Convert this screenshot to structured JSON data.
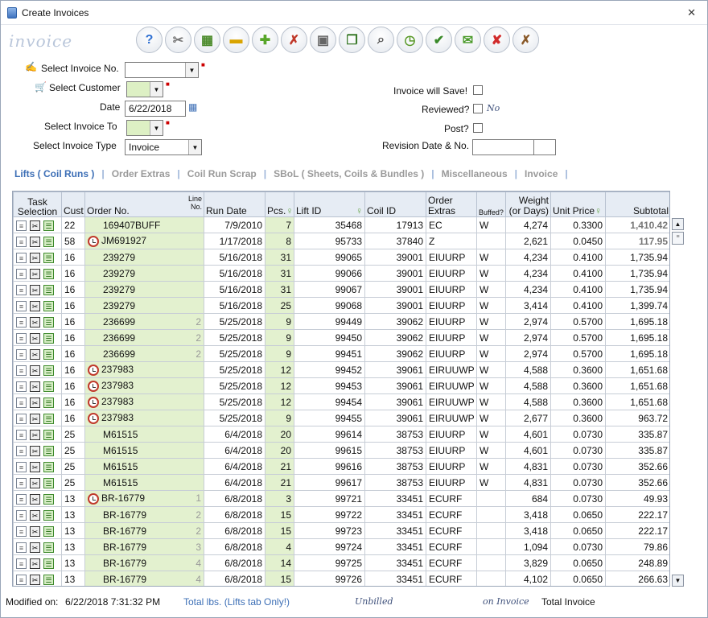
{
  "window": {
    "title": "Create Invoices",
    "close": "✕"
  },
  "logo": "invoice",
  "toolbar": [
    {
      "name": "help-icon",
      "glyph": "?",
      "color": "#2e6fd1"
    },
    {
      "name": "tools-icon",
      "glyph": "✂",
      "color": "#777"
    },
    {
      "name": "grid-icon",
      "glyph": "▦",
      "color": "#4a8a2a"
    },
    {
      "name": "note-icon",
      "glyph": "▬",
      "color": "#d9a400"
    },
    {
      "name": "add-icon",
      "glyph": "✚",
      "color": "#58a62a"
    },
    {
      "name": "remove-filter-icon",
      "glyph": "✗",
      "color": "#c0392b"
    },
    {
      "name": "save-icon",
      "glyph": "▣",
      "color": "#666"
    },
    {
      "name": "copy-icon",
      "glyph": "❐",
      "color": "#3a7a2a"
    },
    {
      "name": "preview-icon",
      "glyph": "⌕",
      "color": "#555"
    },
    {
      "name": "clock-icon",
      "glyph": "◷",
      "color": "#5a9a2a"
    },
    {
      "name": "approve-icon",
      "glyph": "✔",
      "color": "#3a8a2a"
    },
    {
      "name": "email-icon",
      "glyph": "✉",
      "color": "#4a9a2a"
    },
    {
      "name": "delete-icon",
      "glyph": "✘",
      "color": "#d12b2b"
    },
    {
      "name": "cancel-icon",
      "glyph": "✗",
      "color": "#8a5a2a"
    }
  ],
  "form": {
    "select_invoice_label": "Select Invoice No.",
    "select_customer_label": "Select Customer",
    "date_label": "Date",
    "date_value": "6/22/2018",
    "invoice_to_label": "Select Invoice To",
    "invoice_type_label": "Select Invoice Type",
    "invoice_type_value": "Invoice",
    "will_save_label": "Invoice will Save!",
    "reviewed_label": "Reviewed?",
    "reviewed_value": "No",
    "post_label": "Post?",
    "revision_label": "Revision Date & No."
  },
  "tabs": [
    "Lifts ( Coil Runs )",
    "Order Extras",
    "Coil Run Scrap",
    "SBoL ( Sheets, Coils & Bundles )",
    "Miscellaneous",
    "Invoice"
  ],
  "grid": {
    "headers": {
      "task": "Task Selection",
      "cust": "Cust",
      "order": "Order No.",
      "line": "Line No.",
      "run_date": "Run Date",
      "pcs": "Pcs.",
      "lift": "Lift ID",
      "coil": "Coil ID",
      "extras": "Order Extras",
      "buffed": "Buffed?",
      "weight": "Weight (or Days)",
      "price": "Unit Price",
      "subtotal": "Subtotal"
    },
    "rows": [
      {
        "cust": "22",
        "order": "169407BUFF",
        "line": "",
        "clock": false,
        "date": "7/9/2010",
        "pcs": "7",
        "lift": "35468",
        "coil": "17913",
        "extras": "EC",
        "buffed": "W",
        "weight": "4,274",
        "price": "0.3300",
        "subtotal": "1,410.42",
        "gray": true
      },
      {
        "cust": "58",
        "order": "JM691927",
        "line": "",
        "clock": true,
        "date": "1/17/2018",
        "pcs": "8",
        "lift": "95733",
        "coil": "37840",
        "extras": "Z",
        "buffed": "",
        "weight": "2,621",
        "price": "0.0450",
        "subtotal": "117.95",
        "gray": true
      },
      {
        "cust": "16",
        "order": "239279",
        "line": "",
        "clock": false,
        "date": "5/16/2018",
        "pcs": "31",
        "lift": "99065",
        "coil": "39001",
        "extras": "EIUURP",
        "buffed": "W",
        "weight": "4,234",
        "price": "0.4100",
        "subtotal": "1,735.94",
        "gray": false
      },
      {
        "cust": "16",
        "order": "239279",
        "line": "",
        "clock": false,
        "date": "5/16/2018",
        "pcs": "31",
        "lift": "99066",
        "coil": "39001",
        "extras": "EIUURP",
        "buffed": "W",
        "weight": "4,234",
        "price": "0.4100",
        "subtotal": "1,735.94",
        "gray": false
      },
      {
        "cust": "16",
        "order": "239279",
        "line": "",
        "clock": false,
        "date": "5/16/2018",
        "pcs": "31",
        "lift": "99067",
        "coil": "39001",
        "extras": "EIUURP",
        "buffed": "W",
        "weight": "4,234",
        "price": "0.4100",
        "subtotal": "1,735.94",
        "gray": false
      },
      {
        "cust": "16",
        "order": "239279",
        "line": "",
        "clock": false,
        "date": "5/16/2018",
        "pcs": "25",
        "lift": "99068",
        "coil": "39001",
        "extras": "EIUURP",
        "buffed": "W",
        "weight": "3,414",
        "price": "0.4100",
        "subtotal": "1,399.74",
        "gray": false
      },
      {
        "cust": "16",
        "order": "236699",
        "line": "2",
        "clock": false,
        "date": "5/25/2018",
        "pcs": "9",
        "lift": "99449",
        "coil": "39062",
        "extras": "EIUURP",
        "buffed": "W",
        "weight": "2,974",
        "price": "0.5700",
        "subtotal": "1,695.18",
        "gray": false
      },
      {
        "cust": "16",
        "order": "236699",
        "line": "2",
        "clock": false,
        "date": "5/25/2018",
        "pcs": "9",
        "lift": "99450",
        "coil": "39062",
        "extras": "EIUURP",
        "buffed": "W",
        "weight": "2,974",
        "price": "0.5700",
        "subtotal": "1,695.18",
        "gray": false
      },
      {
        "cust": "16",
        "order": "236699",
        "line": "2",
        "clock": false,
        "date": "5/25/2018",
        "pcs": "9",
        "lift": "99451",
        "coil": "39062",
        "extras": "EIUURP",
        "buffed": "W",
        "weight": "2,974",
        "price": "0.5700",
        "subtotal": "1,695.18",
        "gray": false
      },
      {
        "cust": "16",
        "order": "237983",
        "line": "",
        "clock": true,
        "date": "5/25/2018",
        "pcs": "12",
        "lift": "99452",
        "coil": "39061",
        "extras": "EIRUUWP",
        "buffed": "W",
        "weight": "4,588",
        "price": "0.3600",
        "subtotal": "1,651.68",
        "gray": false
      },
      {
        "cust": "16",
        "order": "237983",
        "line": "",
        "clock": true,
        "date": "5/25/2018",
        "pcs": "12",
        "lift": "99453",
        "coil": "39061",
        "extras": "EIRUUWP",
        "buffed": "W",
        "weight": "4,588",
        "price": "0.3600",
        "subtotal": "1,651.68",
        "gray": false
      },
      {
        "cust": "16",
        "order": "237983",
        "line": "",
        "clock": true,
        "date": "5/25/2018",
        "pcs": "12",
        "lift": "99454",
        "coil": "39061",
        "extras": "EIRUUWP",
        "buffed": "W",
        "weight": "4,588",
        "price": "0.3600",
        "subtotal": "1,651.68",
        "gray": false
      },
      {
        "cust": "16",
        "order": "237983",
        "line": "",
        "clock": true,
        "date": "5/25/2018",
        "pcs": "9",
        "lift": "99455",
        "coil": "39061",
        "extras": "EIRUUWP",
        "buffed": "W",
        "weight": "2,677",
        "price": "0.3600",
        "subtotal": "963.72",
        "gray": false
      },
      {
        "cust": "25",
        "order": "M61515",
        "line": "",
        "clock": false,
        "date": "6/4/2018",
        "pcs": "20",
        "lift": "99614",
        "coil": "38753",
        "extras": "EIUURP",
        "buffed": "W",
        "weight": "4,601",
        "price": "0.0730",
        "subtotal": "335.87",
        "gray": false
      },
      {
        "cust": "25",
        "order": "M61515",
        "line": "",
        "clock": false,
        "date": "6/4/2018",
        "pcs": "20",
        "lift": "99615",
        "coil": "38753",
        "extras": "EIUURP",
        "buffed": "W",
        "weight": "4,601",
        "price": "0.0730",
        "subtotal": "335.87",
        "gray": false
      },
      {
        "cust": "25",
        "order": "M61515",
        "line": "",
        "clock": false,
        "date": "6/4/2018",
        "pcs": "21",
        "lift": "99616",
        "coil": "38753",
        "extras": "EIUURP",
        "buffed": "W",
        "weight": "4,831",
        "price": "0.0730",
        "subtotal": "352.66",
        "gray": false
      },
      {
        "cust": "25",
        "order": "M61515",
        "line": "",
        "clock": false,
        "date": "6/4/2018",
        "pcs": "21",
        "lift": "99617",
        "coil": "38753",
        "extras": "EIUURP",
        "buffed": "W",
        "weight": "4,831",
        "price": "0.0730",
        "subtotal": "352.66",
        "gray": false
      },
      {
        "cust": "13",
        "order": "BR-16779",
        "line": "1",
        "clock": true,
        "date": "6/8/2018",
        "pcs": "3",
        "lift": "99721",
        "coil": "33451",
        "extras": "ECURF",
        "buffed": "",
        "weight": "684",
        "price": "0.0730",
        "subtotal": "49.93",
        "gray": false
      },
      {
        "cust": "13",
        "order": "BR-16779",
        "line": "2",
        "clock": false,
        "date": "6/8/2018",
        "pcs": "15",
        "lift": "99722",
        "coil": "33451",
        "extras": "ECURF",
        "buffed": "",
        "weight": "3,418",
        "price": "0.0650",
        "subtotal": "222.17",
        "gray": false
      },
      {
        "cust": "13",
        "order": "BR-16779",
        "line": "2",
        "clock": false,
        "date": "6/8/2018",
        "pcs": "15",
        "lift": "99723",
        "coil": "33451",
        "extras": "ECURF",
        "buffed": "",
        "weight": "3,418",
        "price": "0.0650",
        "subtotal": "222.17",
        "gray": false
      },
      {
        "cust": "13",
        "order": "BR-16779",
        "line": "3",
        "clock": false,
        "date": "6/8/2018",
        "pcs": "4",
        "lift": "99724",
        "coil": "33451",
        "extras": "ECURF",
        "buffed": "",
        "weight": "1,094",
        "price": "0.0730",
        "subtotal": "79.86",
        "gray": false
      },
      {
        "cust": "13",
        "order": "BR-16779",
        "line": "4",
        "clock": false,
        "date": "6/8/2018",
        "pcs": "14",
        "lift": "99725",
        "coil": "33451",
        "extras": "ECURF",
        "buffed": "",
        "weight": "3,829",
        "price": "0.0650",
        "subtotal": "248.89",
        "gray": false
      },
      {
        "cust": "13",
        "order": "BR-16779",
        "line": "4",
        "clock": false,
        "date": "6/8/2018",
        "pcs": "15",
        "lift": "99726",
        "coil": "33451",
        "extras": "ECURF",
        "buffed": "",
        "weight": "4,102",
        "price": "0.0650",
        "subtotal": "266.63",
        "gray": false
      }
    ]
  },
  "footer": {
    "modified_label": "Modified on:",
    "modified_value": "6/22/2018 7:31:32 PM",
    "total_lbs_label": "Total lbs. (Lifts tab Only!)",
    "unbilled_label": "Unbilled",
    "on_invoice_label": "on Invoice",
    "total_invoice_label": "Total Invoice"
  }
}
